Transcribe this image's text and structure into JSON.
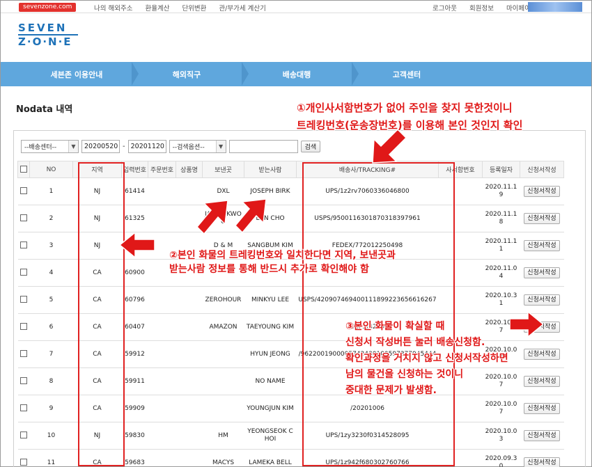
{
  "topbar": {
    "site_badge": "sevenzone.com",
    "links": [
      "나의 해외주소",
      "환율계산",
      "단위변환",
      "관/부가세 계산기"
    ],
    "user_links": [
      "로그아웃",
      "회원정보",
      "마이페이지"
    ]
  },
  "logo": {
    "line1": "SEVEN",
    "line2": "Z·O·N·E"
  },
  "nav": [
    "세븐존 이용안내",
    "해외직구",
    "배송대행",
    "고객센터"
  ],
  "page_title": "Nodata 내역",
  "filters": {
    "center_select": "--배송센터--",
    "date_from": "20200520",
    "date_sep": "-",
    "date_to": "20201120",
    "search_option": "--검색옵션--",
    "search_value": "",
    "search_button": "검색"
  },
  "table": {
    "headers": [
      "NO",
      "지역",
      "입력번호",
      "주문번호",
      "상품명",
      "보낸곳",
      "받는사람",
      "배송사/TRACKING#",
      "사서함번호",
      "등록일자",
      "신청서작성"
    ],
    "action_label": "신청서작성",
    "rows": [
      {
        "no": "1",
        "region": "NJ",
        "input_no": "61414",
        "order_no": "",
        "product": "",
        "sender": "DXL",
        "recipient": "JOSEPH BIRK",
        "tracking": "UPS/1z2rv7060336046800",
        "pobox": "",
        "date": "2020.11.19"
      },
      {
        "no": "2",
        "region": "NJ",
        "input_no": "61325",
        "order_no": "",
        "product": "",
        "sender": "JASON KWOO",
        "recipient": "LAN CHO",
        "tracking": "USPS/9500116301870318397961",
        "pobox": "",
        "date": "2020.11.18"
      },
      {
        "no": "3",
        "region": "NJ",
        "input_no": "",
        "order_no": "",
        "product": "",
        "sender": "D & M",
        "recipient": "SANGBUM KIM",
        "tracking": "FEDEX/772012250498",
        "pobox": "",
        "date": "2020.11.11"
      },
      {
        "no": "4",
        "region": "CA",
        "input_no": "60900",
        "order_no": "",
        "product": "",
        "sender": "",
        "recipient": "",
        "tracking": "",
        "pobox": "",
        "date": "2020.11.04"
      },
      {
        "no": "5",
        "region": "CA",
        "input_no": "60796",
        "order_no": "",
        "product": "",
        "sender": "ZEROHOUR",
        "recipient": "MINKYU LEE",
        "tracking": "USPS/42090746940011189922365661626​7",
        "pobox": "",
        "date": "2020.10.31"
      },
      {
        "no": "6",
        "region": "CA",
        "input_no": "60407",
        "order_no": "",
        "product": "",
        "sender": "AMAZON",
        "recipient": "TAEYOUNG KIM",
        "tracking": "USPS/4209",
        "pobox": "",
        "date": "2020.10.27"
      },
      {
        "no": "7",
        "region": "CA",
        "input_no": "59912",
        "order_no": "",
        "product": "",
        "sender": "",
        "recipient": "HYUN JEONG",
        "tracking": "/9622001900005742480100597377945444",
        "pobox": "",
        "date": "2020.10.07"
      },
      {
        "no": "8",
        "region": "CA",
        "input_no": "59911",
        "order_no": "",
        "product": "",
        "sender": "",
        "recipient": "NO NAME",
        "tracking": "",
        "pobox": "",
        "date": "2020.10.07"
      },
      {
        "no": "9",
        "region": "CA",
        "input_no": "59909",
        "order_no": "",
        "product": "",
        "sender": "",
        "recipient": "YOUNGJUN KIM",
        "tracking": "/20201006",
        "pobox": "",
        "date": "2020.10.07"
      },
      {
        "no": "10",
        "region": "NJ",
        "input_no": "59830",
        "order_no": "",
        "product": "",
        "sender": "HM",
        "recipient": "YEONGSEOK CHOI",
        "tracking": "UPS/1zy3230f0314528095",
        "pobox": "",
        "date": "2020.10.03"
      },
      {
        "no": "11",
        "region": "CA",
        "input_no": "59683",
        "order_no": "",
        "product": "",
        "sender": "MACYS",
        "recipient": "LAMEKA BELL",
        "tracking": "UPS/1z942f680302760766",
        "pobox": "",
        "date": "2020.09.30"
      }
    ]
  },
  "annotations": {
    "note1_line1": "①개인사서함번호가 없어 주인을 찾지 못한것이니",
    "note1_line2": "트레킹번호(운송장번호)를 이용해 본인 것인지 확인",
    "note2_line1": "②본인 화물의 트레킹번호와 일치한다면 지역, 보낸곳과",
    "note2_line2": "받는사람 정보를 통해 반드시 추가로 확인해야 함",
    "note3_line1": "③본인 화물이 확실할 때",
    "note3_line2": "신청서 작성버튼 눌러 배송신청함.",
    "note3_line3": "확인과정을 거치지 않고 신청서작성하면",
    "note3_line4": "남의 물건을 신청하는 것이니",
    "note3_line5": "중대한 문제가 발생함.",
    "color": "#e01818"
  }
}
